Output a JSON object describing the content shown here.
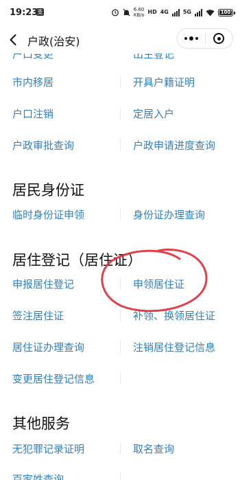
{
  "status_bar": {
    "time": "19:23",
    "app_icon": "支",
    "network_speed": "6.60",
    "network_unit": "KB/s",
    "signal_1": "4G",
    "signal_2": "5G",
    "battery": "100"
  },
  "nav": {
    "title": "户政(治安)"
  },
  "top_partial_links": [
    "户口变更",
    "出生登记"
  ],
  "huzheng_links": [
    [
      "市内移居",
      "开具户籍证明"
    ],
    [
      "户口注销",
      "定居入户"
    ],
    [
      "户政审批查询",
      "户政申请进度查询"
    ]
  ],
  "sections": {
    "id_card": {
      "title": "居民身份证",
      "links": [
        [
          "临时身份证申领",
          "身份证办理查询"
        ]
      ]
    },
    "residence": {
      "title": "居住登记（居住证）",
      "links": [
        [
          "申报居住登记",
          "申领居住证"
        ],
        [
          "签注居住证",
          "补领、换领居住证"
        ],
        [
          "居住证办理查询",
          "注销居住登记信息"
        ],
        [
          "变更居住登记信息",
          ""
        ]
      ]
    },
    "other": {
      "title": "其他服务",
      "links": [
        [
          "无犯罪记录证明",
          "取名查询"
        ],
        [
          "百家姓查询",
          ""
        ]
      ]
    }
  },
  "colors": {
    "link": "#2f7fc1",
    "annotation": "#e0303a"
  }
}
